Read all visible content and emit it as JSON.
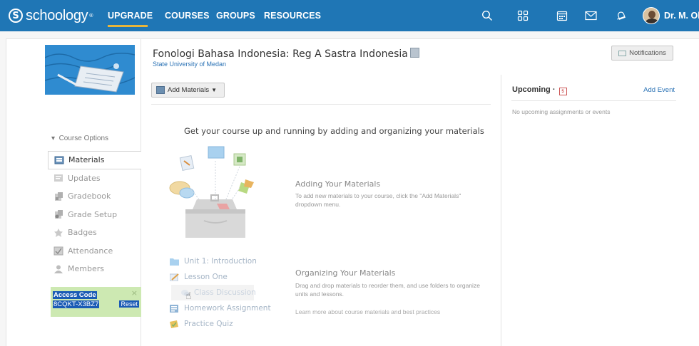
{
  "topnav": {
    "logo_text": "schoology",
    "logo_letter": "S",
    "links": {
      "upgrade": "UPGRADE",
      "courses": "COURSES",
      "groups": "GROUPS",
      "resources": "RESOURCES"
    },
    "user_name": "Dr. M. Oky",
    "colors": {
      "bar": "#1f76b5",
      "active_underline": "#e8b53a"
    },
    "icons": [
      "search-icon",
      "apps-grid-icon",
      "calendar-icon",
      "mail-icon",
      "notifications-icon"
    ]
  },
  "sidebar": {
    "course_options_label": "Course Options",
    "items": [
      {
        "label": "Materials",
        "icon": "materials-icon",
        "active": true
      },
      {
        "label": "Updates",
        "icon": "updates-icon"
      },
      {
        "label": "Gradebook",
        "icon": "gradebook-icon"
      },
      {
        "label": "Grade Setup",
        "icon": "grade-setup-icon"
      },
      {
        "label": "Badges",
        "icon": "badges-icon"
      },
      {
        "label": "Attendance",
        "icon": "attendance-icon"
      },
      {
        "label": "Members",
        "icon": "members-icon"
      }
    ],
    "access": {
      "label": "Access Code",
      "code": "8CQKT-X3BZ7",
      "reset_label": "Reset",
      "close_glyph": "×"
    }
  },
  "course": {
    "title": "Fonologi Bahasa Indonesia: Reg A Sastra Indonesia",
    "school": "State University of Medan",
    "notifications_label": "Notifications",
    "add_materials_label": "Add Materials"
  },
  "intro": {
    "heading": "Get your course up and running by adding and organizing your materials",
    "adding_title": "Adding Your Materials",
    "adding_text": "To add new materials to your course, click the \"Add Materials\" dropdown menu.",
    "organizing_title": "Organizing Your Materials",
    "organizing_text": "Drag and drop materials to reorder them, and use folders to organize units and lessons.",
    "learn_more": "Learn more about course materials and best practices",
    "sample_items": [
      {
        "label": "Unit 1: Introduction",
        "icon": "folder-icon"
      },
      {
        "label": "Lesson One",
        "icon": "pencil-icon"
      },
      {
        "label": "Class Discussion",
        "icon": "discussion-icon"
      },
      {
        "label": "Homework Assignment",
        "icon": "assignment-icon"
      },
      {
        "label": "Practice Quiz",
        "icon": "quiz-icon"
      }
    ]
  },
  "upcoming": {
    "title": "Upcoming",
    "add_event_label": "Add Event",
    "empty_text": "No upcoming assignments or events",
    "cal_day": "5"
  }
}
